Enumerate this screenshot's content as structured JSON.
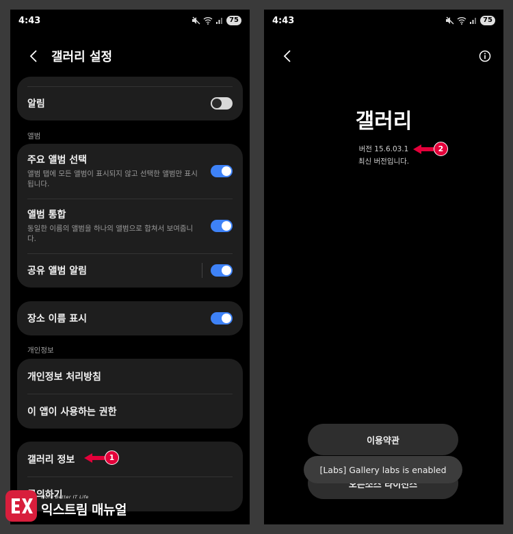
{
  "left_screen": {
    "status": {
      "time": "4:43",
      "battery": "75"
    },
    "header": {
      "title": "갤러리 설정"
    },
    "card_notifications": {
      "label": "알림",
      "toggle": "off"
    },
    "section_album": "앨범",
    "album_items": [
      {
        "title": "주요 앨범 선택",
        "subtitle": "앨범 탭에 모든 앨범이 표시되지 않고 선택한 앨범만 표시됩니다.",
        "toggle": "on"
      },
      {
        "title": "앨범 통합",
        "subtitle": "동일한 이름의 앨범을 하나의 앨범으로 합쳐서 보여줍니다.",
        "toggle": "on"
      },
      {
        "title": "공유 앨범 알림",
        "toggle": "on"
      }
    ],
    "card_location": {
      "label": "장소 이름 표시",
      "toggle": "on"
    },
    "section_privacy": "개인정보",
    "privacy_items": [
      {
        "label": "개인정보 처리방침"
      },
      {
        "label": "이 앱이 사용하는 권한"
      }
    ],
    "about_items": [
      {
        "label": "갤러리 정보"
      },
      {
        "label": "문의하기"
      }
    ],
    "annotation_1": "1"
  },
  "right_screen": {
    "status": {
      "time": "4:43",
      "battery": "75"
    },
    "app_name": "갤러리",
    "version": "버전 15.6.03.1",
    "latest": "최신 버전입니다.",
    "annotation_2": "2",
    "terms_button": "이용약관",
    "oss_button": "오픈소스 라이선스",
    "toast": "[Labs] Gallery labs is enabled"
  },
  "watermark": {
    "tagline": "More Better IT Life",
    "name": "익스트림 매뉴얼"
  },
  "colors": {
    "accent": "#3e82f7",
    "card": "#1e1e1e",
    "annotation": "#e4003a",
    "brand": "#d81e3c"
  }
}
